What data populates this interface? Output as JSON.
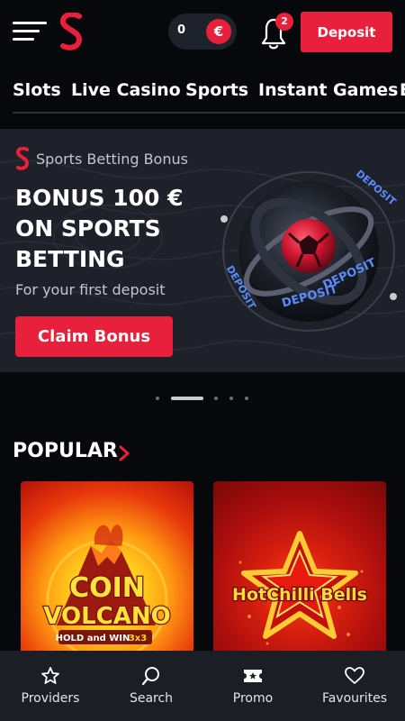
{
  "header": {
    "balance_amount": "0",
    "currency_symbol": "€",
    "notification_count": "2",
    "deposit_label": "Deposit"
  },
  "categories": [
    "Slots",
    "Live Casino",
    "Sports",
    "Instant Games",
    "E"
  ],
  "banner": {
    "tag": "Sports Betting Bonus",
    "headline_lines": [
      "BONUS 100 €",
      "ON SPORTS",
      "BETTING"
    ],
    "subtitle": "For your first deposit",
    "cta_label": "Claim Bonus",
    "art_text": "DEPOSIT",
    "slides_total": 5,
    "active_slide": 2
  },
  "popular": {
    "title": "POPULAR",
    "games": [
      {
        "title_line1": "COIN",
        "title_line2": "VOLCANO",
        "subtitle": "HOLD and WIN",
        "badge": "3x3"
      },
      {
        "title": "HotChilli Bells"
      }
    ]
  },
  "bottom_nav": [
    {
      "label": "Providers",
      "icon": "star-icon"
    },
    {
      "label": "Search",
      "icon": "search-icon"
    },
    {
      "label": "Promo",
      "icon": "ticket-icon"
    },
    {
      "label": "Favourites",
      "icon": "heart-icon"
    }
  ],
  "colors": {
    "background": "#07080c",
    "accent_red": "#e8203b",
    "banner_bg": "#1e2129",
    "nav_bg": "#1b1e25"
  }
}
